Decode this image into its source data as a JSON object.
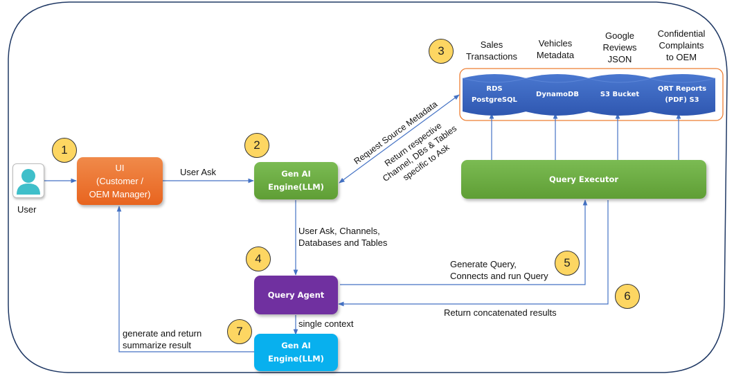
{
  "diagram": {
    "actor": {
      "label": "User",
      "icon": "user-icon"
    },
    "nodes": {
      "ui": {
        "label": "UI\n(Customer /\nOEM Manager)",
        "color": "#ec7131"
      },
      "gen_ai_1": {
        "label": "Gen AI\nEngine(LLM)",
        "color": "#6aac3f"
      },
      "query_agent": {
        "label": "Query Agent",
        "color": "#7030a0"
      },
      "gen_ai_2": {
        "label": "Gen AI\nEngine(LLM)",
        "color": "#00b0f0"
      },
      "query_executor": {
        "label": "Query Executor",
        "color": "#6aac3f"
      }
    },
    "data_sources": [
      {
        "title": "Sales\nTransactions",
        "label": "RDS\nPostgreSQL"
      },
      {
        "title": "Vehicles\nMetadata",
        "label": "DynamoDB"
      },
      {
        "title": "Google\nReviews\nJSON",
        "label": "S3 Bucket"
      },
      {
        "title": "Confidential\nComplaints\nto OEM",
        "label": "QRT Reports\n(PDF) S3"
      }
    ],
    "steps": [
      "1",
      "2",
      "3",
      "4",
      "5",
      "6",
      "7"
    ],
    "edge_labels": {
      "user_ask": "User Ask",
      "request_metadata": "Request Source Metadata",
      "return_channels": "Return respective\nChannel, DBs & Tables\nspecific to Ask",
      "to_agent": "User Ask, Channels,\nDatabases and Tables",
      "generate_query": "Generate Query,\nConnects and run Query",
      "return_results": "Return concatenated results",
      "single_context": "single context",
      "summarize": "generate and return\nsummarize result"
    },
    "colors": {
      "border": "#1f3864",
      "arrow": "#4472c4",
      "source_group": "#ed7d31",
      "cylinder": "#3a64c0",
      "badge": "#fdd662"
    }
  }
}
